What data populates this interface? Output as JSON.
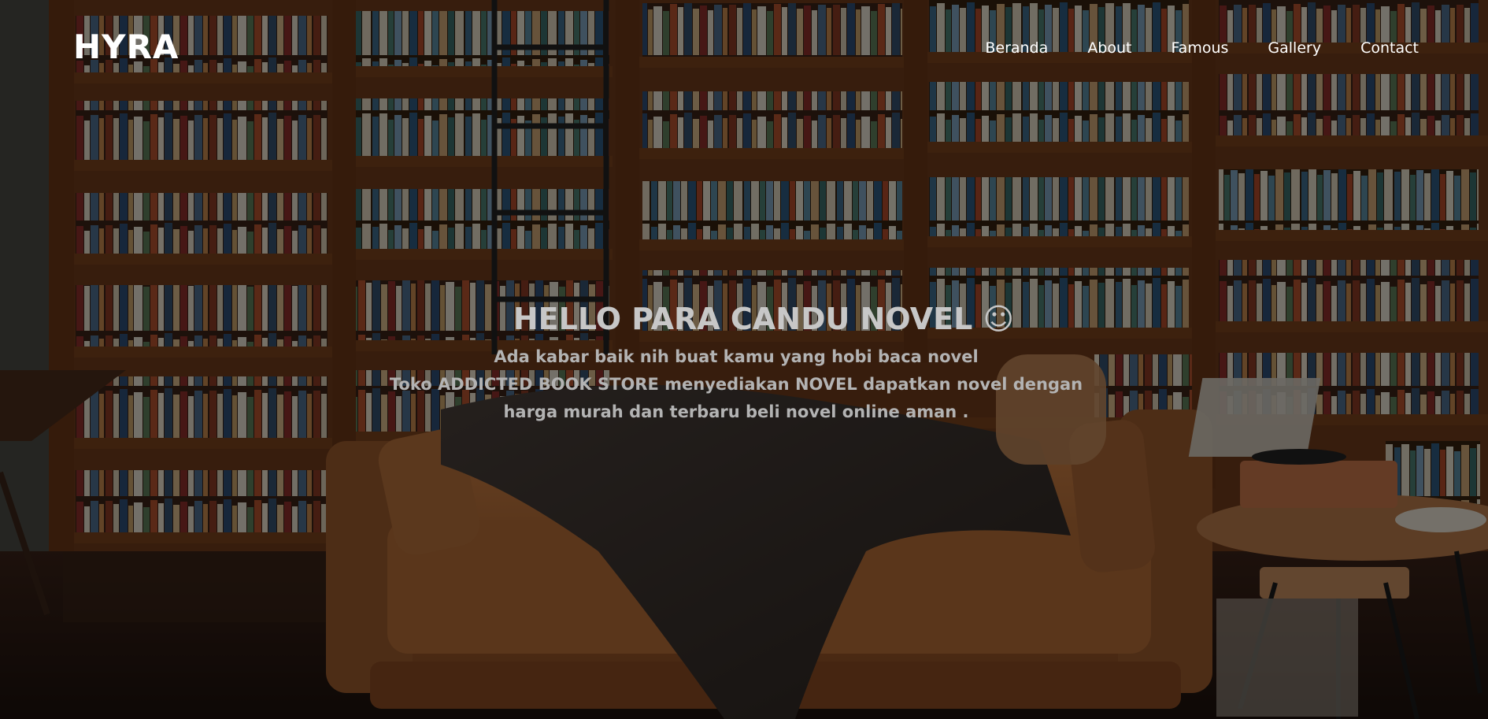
{
  "nav": {
    "logo": "HYRA",
    "items": [
      {
        "label": "Beranda"
      },
      {
        "label": "About"
      },
      {
        "label": "Famous"
      },
      {
        "label": "Gallery"
      },
      {
        "label": "Contact"
      }
    ]
  },
  "hero": {
    "headline": "HELLO PARA CANDU NOVEL ☺",
    "lines": [
      "Ada kabar baik nih buat kamu yang hobi baca novel",
      "Toko ADDICTED BOOK STORE menyediakan NOVEL dapatkan novel dengan",
      "harga murah dan terbaru beli novel online aman ."
    ]
  },
  "colors": {
    "wood": "#6e3a1a",
    "sofa": "#a5602f",
    "blanket": "#3a2f2b",
    "text": "#ffffff"
  }
}
